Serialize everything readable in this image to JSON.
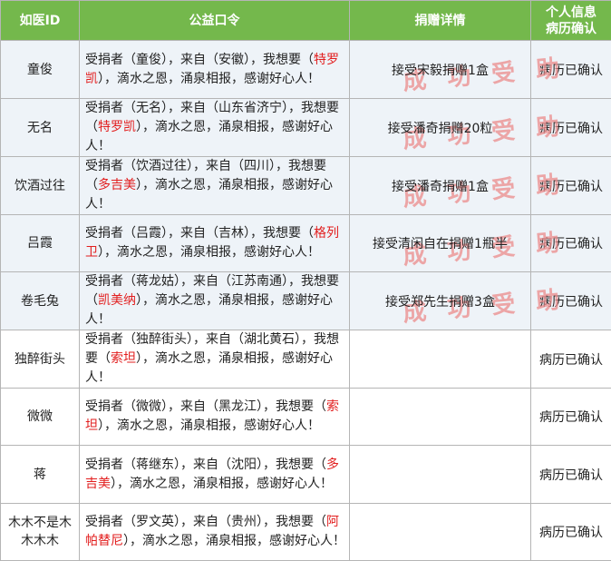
{
  "header": {
    "id": "如医ID",
    "slogan": "公益口令",
    "detail": "捐赠详情",
    "status_line1": "个人信息",
    "status_line2": "病历确认"
  },
  "stamp_text": "成 功 受 助",
  "rows": [
    {
      "id": "童俊",
      "pre": "受捐者（童俊），来自（安徽），我想要（",
      "med": "特罗凯",
      "post": "），滴水之恩，涌泉相报，感谢好心人！",
      "detail": "接受宋毅捐赠1盒",
      "status": "病历已确认"
    },
    {
      "id": "无名",
      "pre": "受捐者（无名），来自（山东省济宁），我想要（",
      "med": "特罗凯",
      "post": "），滴水之恩，涌泉相报，感谢好心人！",
      "detail": "接受潘奇捐赠20粒",
      "status": "病历已确认"
    },
    {
      "id": "饮酒过往",
      "pre": "受捐者（饮酒过往），来自（四川），我想要（",
      "med": "多吉美",
      "post": "），滴水之恩，涌泉相报，感谢好心人！",
      "detail": "接受潘奇捐赠1盒",
      "status": "病历已确认"
    },
    {
      "id": "吕霞",
      "pre": "受捐者（吕霞），来自（吉林），我想要（",
      "med": "格列卫",
      "post": "），滴水之恩，涌泉相报，感谢好心人！",
      "detail": "接受清闲自在捐赠1瓶半",
      "status": "病历已确认"
    },
    {
      "id": "卷毛兔",
      "pre": "受捐者（蒋龙姑），来自（江苏南通），我想要（",
      "med": "凯美纳",
      "post": "），滴水之恩，涌泉相报，感谢好心人！",
      "detail": "接受郑先生捐赠3盒",
      "status": "病历已确认"
    },
    {
      "id": "独醉街头",
      "pre": "受捐者（独醉街头），来自（湖北黄石），我想要（",
      "med": "索坦",
      "post": "），滴水之恩，涌泉相报，感谢好心人！",
      "detail": "",
      "status": "病历已确认"
    },
    {
      "id": "微微",
      "pre": "受捐者（微微），来自（黑龙江），我想要（",
      "med": "索坦",
      "post": "），滴水之恩，涌泉相报，感谢好心人！",
      "detail": "",
      "status": "病历已确认"
    },
    {
      "id": "蒋",
      "pre": "受捐者（蒋继东），来自（沈阳），我想要（",
      "med": "多吉美",
      "post": "），滴水之恩，涌泉相报，感谢好心人！",
      "detail": "",
      "status": "病历已确认"
    },
    {
      "id": "木木不是木木木木",
      "pre": "受捐者（罗文英），来自（贵州），我想要（",
      "med": "阿帕替尼",
      "post": "），滴水之恩，涌泉相报，感谢好心人！",
      "detail": "",
      "status": "病历已确认"
    }
  ]
}
